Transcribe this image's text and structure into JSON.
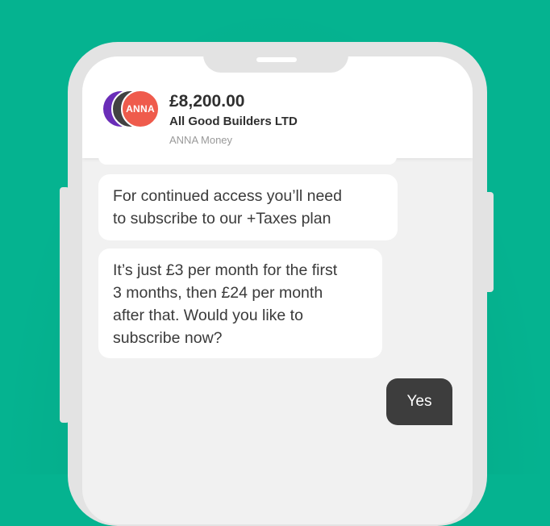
{
  "header": {
    "avatar_text": "ANNA",
    "amount": "£8,200.00",
    "company": "All Good Builders LTD",
    "sender": "ANNA Money"
  },
  "messages": [
    {
      "from": "anna",
      "lines": [
        "For continued access you’ll need",
        "to subscribe to our +Taxes plan"
      ]
    },
    {
      "from": "anna",
      "lines": [
        "It’s just £3 per month for the first",
        "3 months, then £24 per month",
        "after that. Would you like to",
        "subscribe now?"
      ]
    }
  ],
  "reply": {
    "label": "Yes"
  },
  "colors": {
    "background": "#05b390",
    "brand_avatar": "#ef5b4c",
    "reply_bubble": "#3d3d3d"
  }
}
